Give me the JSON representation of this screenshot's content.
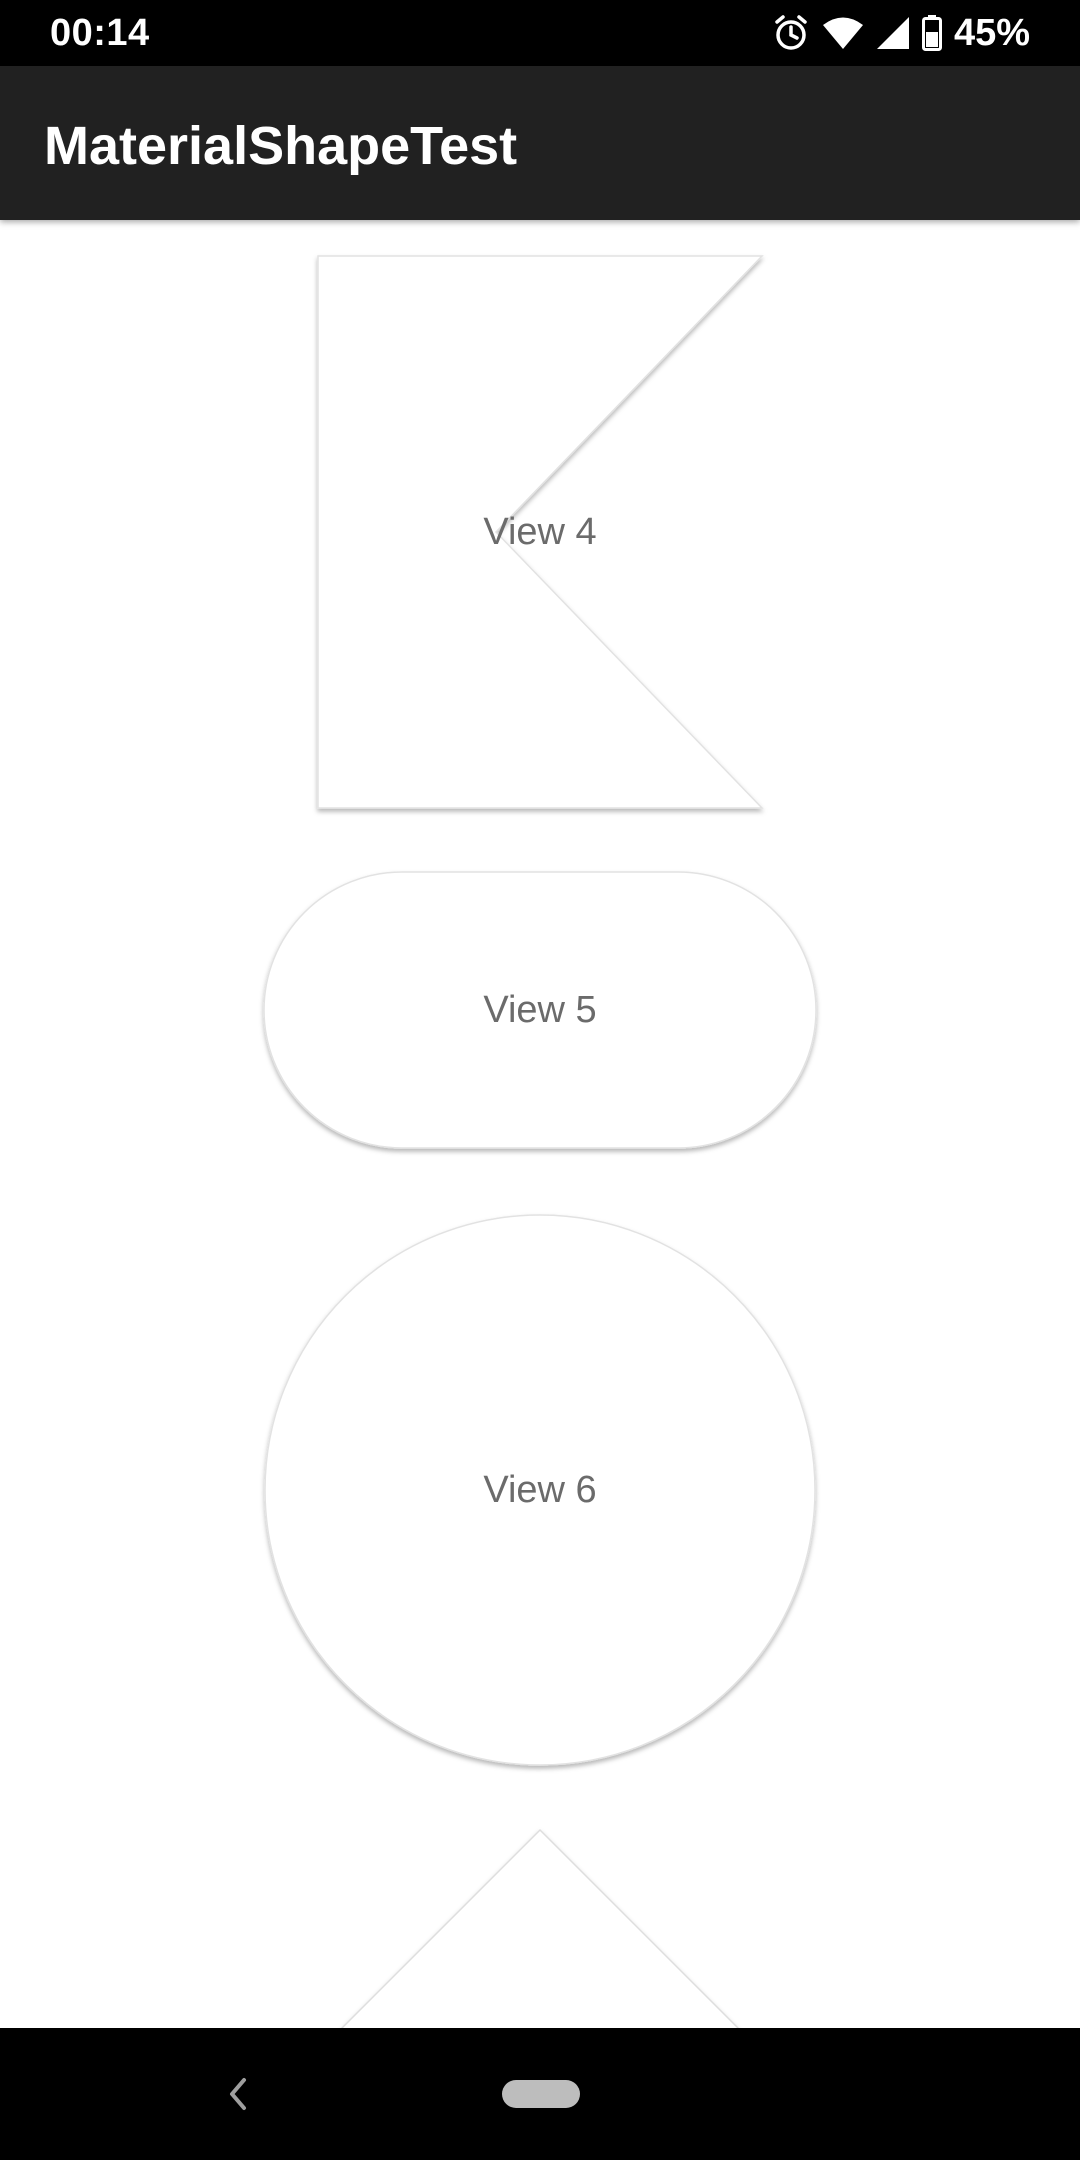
{
  "status_bar": {
    "time": "00:14",
    "battery_percent": "45%",
    "icons": [
      "alarm-icon",
      "wifi-icon",
      "cell-signal-icon",
      "battery-icon"
    ]
  },
  "app_bar": {
    "title": "MaterialShapeTest",
    "background": "#212121"
  },
  "views": [
    {
      "label": "View 4",
      "shape": "rectangle-with-triangular-notch"
    },
    {
      "label": "View 5",
      "shape": "pill"
    },
    {
      "label": "View 6",
      "shape": "circle"
    },
    {
      "label": "",
      "shape": "triangle"
    }
  ],
  "nav_bar": {
    "icons": [
      "back-icon",
      "home-pill-icon"
    ]
  },
  "colors": {
    "label_text": "#6b6b6b",
    "shape_fill": "#ffffff",
    "shape_edge": "#d6d6d6"
  }
}
